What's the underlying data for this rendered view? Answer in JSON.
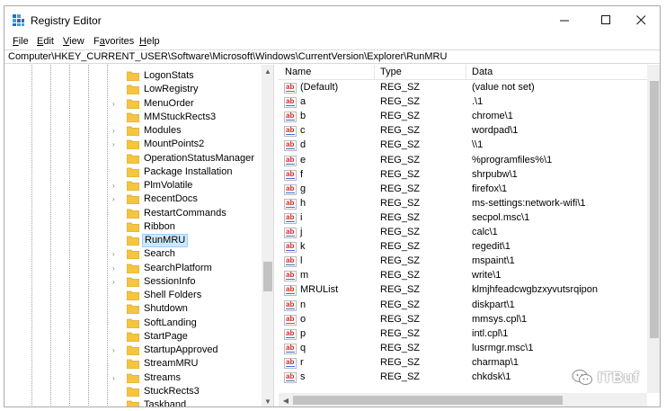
{
  "window": {
    "title": "Registry Editor",
    "minimize_glyph": "—",
    "maximize_glyph": "☐",
    "close_glyph": "✕"
  },
  "menu": {
    "items": [
      {
        "accel": "F",
        "rest": "ile"
      },
      {
        "accel": "E",
        "rest": "dit"
      },
      {
        "accel": "V",
        "rest": "iew"
      },
      {
        "pre": "F",
        "accel": "a",
        "rest": "vorites"
      },
      {
        "accel": "H",
        "rest": "elp"
      }
    ]
  },
  "address": {
    "path": "Computer\\HKEY_CURRENT_USER\\Software\\Microsoft\\Windows\\CurrentVersion\\Explorer\\RunMRU"
  },
  "tree": {
    "expand_glyph": "›",
    "up_glyph": "▲",
    "down_glyph": "▼",
    "selected": "RunMRU",
    "items": [
      {
        "label": "LogonStats",
        "expandable": false
      },
      {
        "label": "LowRegistry",
        "expandable": false
      },
      {
        "label": "MenuOrder",
        "expandable": true
      },
      {
        "label": "MMStuckRects3",
        "expandable": false
      },
      {
        "label": "Modules",
        "expandable": true
      },
      {
        "label": "MountPoints2",
        "expandable": true
      },
      {
        "label": "OperationStatusManager",
        "expandable": false
      },
      {
        "label": "Package Installation",
        "expandable": false
      },
      {
        "label": "PlmVolatile",
        "expandable": true
      },
      {
        "label": "RecentDocs",
        "expandable": true
      },
      {
        "label": "RestartCommands",
        "expandable": false
      },
      {
        "label": "Ribbon",
        "expandable": false
      },
      {
        "label": "RunMRU",
        "expandable": false
      },
      {
        "label": "Search",
        "expandable": true
      },
      {
        "label": "SearchPlatform",
        "expandable": true
      },
      {
        "label": "SessionInfo",
        "expandable": true
      },
      {
        "label": "Shell Folders",
        "expandable": false
      },
      {
        "label": "Shutdown",
        "expandable": false
      },
      {
        "label": "SoftLanding",
        "expandable": false
      },
      {
        "label": "StartPage",
        "expandable": false
      },
      {
        "label": "StartupApproved",
        "expandable": true
      },
      {
        "label": "StreamMRU",
        "expandable": false
      },
      {
        "label": "Streams",
        "expandable": true
      },
      {
        "label": "StuckRects3",
        "expandable": false
      },
      {
        "label": "Taskband",
        "expandable": false
      }
    ]
  },
  "values": {
    "columns": [
      "Name",
      "Type",
      "Data"
    ],
    "icon_text": "ab",
    "left_glyph": "◀",
    "rows": [
      {
        "name": "(Default)",
        "type": "REG_SZ",
        "data": "(value not set)"
      },
      {
        "name": "a",
        "type": "REG_SZ",
        "data": ".\\1"
      },
      {
        "name": "b",
        "type": "REG_SZ",
        "data": "chrome\\1"
      },
      {
        "name": "c",
        "type": "REG_SZ",
        "data": "wordpad\\1"
      },
      {
        "name": "d",
        "type": "REG_SZ",
        "data": "\\\\1"
      },
      {
        "name": "e",
        "type": "REG_SZ",
        "data": "%programfiles%\\1"
      },
      {
        "name": "f",
        "type": "REG_SZ",
        "data": "shrpubw\\1"
      },
      {
        "name": "g",
        "type": "REG_SZ",
        "data": "firefox\\1"
      },
      {
        "name": "h",
        "type": "REG_SZ",
        "data": "ms-settings:network-wifi\\1"
      },
      {
        "name": "i",
        "type": "REG_SZ",
        "data": "secpol.msc\\1"
      },
      {
        "name": "j",
        "type": "REG_SZ",
        "data": "calc\\1"
      },
      {
        "name": "k",
        "type": "REG_SZ",
        "data": "regedit\\1"
      },
      {
        "name": "l",
        "type": "REG_SZ",
        "data": "mspaint\\1"
      },
      {
        "name": "m",
        "type": "REG_SZ",
        "data": "write\\1"
      },
      {
        "name": "MRUList",
        "type": "REG_SZ",
        "data": "klmjhfeadcwgbzxyvutsrqipon"
      },
      {
        "name": "n",
        "type": "REG_SZ",
        "data": "diskpart\\1"
      },
      {
        "name": "o",
        "type": "REG_SZ",
        "data": "mmsys.cpl\\1"
      },
      {
        "name": "p",
        "type": "REG_SZ",
        "data": "intl.cpl\\1"
      },
      {
        "name": "q",
        "type": "REG_SZ",
        "data": "lusrmgr.msc\\1"
      },
      {
        "name": "r",
        "type": "REG_SZ",
        "data": "charmap\\1"
      },
      {
        "name": "s",
        "type": "REG_SZ",
        "data": "chkdsk\\1"
      }
    ]
  },
  "watermark": {
    "text": "ITBuf"
  },
  "colors": {
    "selection_bg": "#cce8ff",
    "folder": "#f5c542",
    "string_icon_red": "#dd2222"
  }
}
